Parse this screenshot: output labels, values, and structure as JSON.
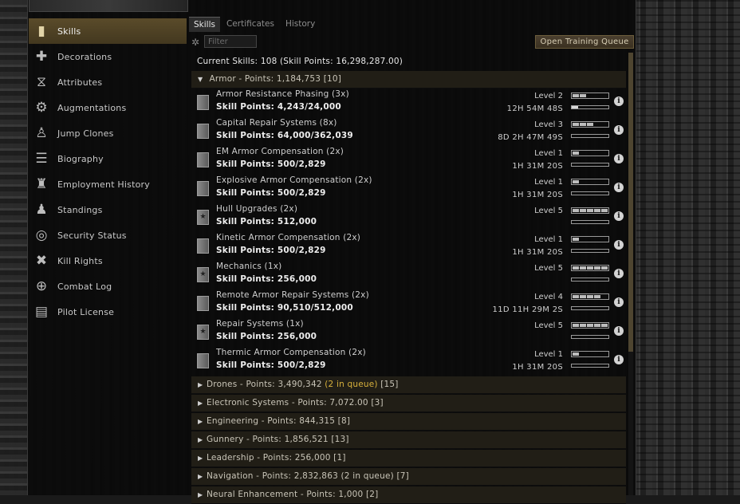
{
  "sidebar": {
    "items": [
      {
        "label": "Skills",
        "icon": "skill-book-icon",
        "glyph": "▮",
        "active": true
      },
      {
        "label": "Decorations",
        "icon": "medal-icon",
        "glyph": "✚",
        "active": false
      },
      {
        "label": "Attributes",
        "icon": "dna-icon",
        "glyph": "⧖",
        "active": false
      },
      {
        "label": "Augmentations",
        "icon": "implant-icon",
        "glyph": "⚙",
        "active": false
      },
      {
        "label": "Jump Clones",
        "icon": "clone-icon",
        "glyph": "♙",
        "active": false
      },
      {
        "label": "Biography",
        "icon": "biography-icon",
        "glyph": "☰",
        "active": false
      },
      {
        "label": "Employment History",
        "icon": "employment-icon",
        "glyph": "♜",
        "active": false
      },
      {
        "label": "Standings",
        "icon": "standings-icon",
        "glyph": "♟",
        "active": false
      },
      {
        "label": "Security Status",
        "icon": "security-icon",
        "glyph": "◎",
        "active": false
      },
      {
        "label": "Kill Rights",
        "icon": "kill-rights-icon",
        "glyph": "✖",
        "active": false
      },
      {
        "label": "Combat Log",
        "icon": "crosshair-icon",
        "glyph": "⊕",
        "active": false
      },
      {
        "label": "Pilot License",
        "icon": "license-icon",
        "glyph": "▤",
        "active": false
      }
    ]
  },
  "tabs": [
    {
      "label": "Skills",
      "active": true
    },
    {
      "label": "Certificates",
      "active": false
    },
    {
      "label": "History",
      "active": false
    }
  ],
  "filter": {
    "placeholder": "Filter",
    "value": ""
  },
  "queue_button": "Open Training Queue",
  "current_skills": "Current Skills: 108 (Skill Points: 16,298,287.00)",
  "armor_group": {
    "title": "Armor - Points: 1,184,753",
    "count": "[10]"
  },
  "skills": [
    {
      "name": "Armor Resistance Phasing (3x)",
      "points": "Skill Points: 4,243/24,000",
      "level": "Level 2",
      "level_num": 2,
      "time": "12H 54M 48S",
      "progress": 0.18,
      "icon": "skill-book-icon",
      "book": ""
    },
    {
      "name": "Capital Repair Systems (8x)",
      "points": "Skill Points: 64,000/362,039",
      "level": "Level 3",
      "level_num": 3,
      "time": "8D 2H 47M 49S",
      "progress": 0.0,
      "icon": "skill-book-icon",
      "book": ""
    },
    {
      "name": "EM Armor Compensation (2x)",
      "points": "Skill Points: 500/2,829",
      "level": "Level 1",
      "level_num": 1,
      "time": "1H 31M 20S",
      "progress": 0.0,
      "icon": "skill-book-icon",
      "book": ""
    },
    {
      "name": "Explosive Armor Compensation (2x)",
      "points": "Skill Points: 500/2,829",
      "level": "Level 1",
      "level_num": 1,
      "time": "1H 31M 20S",
      "progress": 0.0,
      "icon": "skill-book-icon",
      "book": ""
    },
    {
      "name": "Hull Upgrades (2x)",
      "points": "Skill Points: 512,000",
      "level": "Level 5",
      "level_num": 5,
      "time": "",
      "progress": 0.0,
      "icon": "skill-book-star-icon",
      "book": "★"
    },
    {
      "name": "Kinetic Armor Compensation (2x)",
      "points": "Skill Points: 500/2,829",
      "level": "Level 1",
      "level_num": 1,
      "time": "1H 31M 20S",
      "progress": 0.0,
      "icon": "skill-book-icon",
      "book": ""
    },
    {
      "name": "Mechanics (1x)",
      "points": "Skill Points: 256,000",
      "level": "Level 5",
      "level_num": 5,
      "time": "",
      "progress": 0.0,
      "icon": "skill-book-star-icon",
      "book": "★"
    },
    {
      "name": "Remote Armor Repair Systems (2x)",
      "points": "Skill Points: 90,510/512,000",
      "level": "Level 4",
      "level_num": 4,
      "time": "11D 11H 29M 2S",
      "progress": 0.0,
      "icon": "skill-book-icon",
      "book": ""
    },
    {
      "name": "Repair Systems (1x)",
      "points": "Skill Points: 256,000",
      "level": "Level 5",
      "level_num": 5,
      "time": "",
      "progress": 0.0,
      "icon": "skill-book-star-icon",
      "book": "★"
    },
    {
      "name": "Thermic Armor Compensation (2x)",
      "points": "Skill Points: 500/2,829",
      "level": "Level 1",
      "level_num": 1,
      "time": "1H 31M 20S",
      "progress": 0.0,
      "icon": "skill-book-icon",
      "book": ""
    }
  ],
  "groups": [
    {
      "title": "Drones - Points: 3,490,342",
      "queue": "(2 in queue)",
      "count": "[15]"
    },
    {
      "title": "Electronic Systems - Points: 7,072.00",
      "queue": "",
      "count": "[3]"
    },
    {
      "title": "Engineering - Points: 844,315",
      "queue": "",
      "count": "[8]"
    },
    {
      "title": "Gunnery - Points: 1,856,521",
      "queue": "",
      "count": "[13]"
    },
    {
      "title": "Leadership - Points: 256,000",
      "queue": "",
      "count": "[1]"
    },
    {
      "title": "Navigation - Points: 2,832,863 (2 in queue)",
      "queue": "",
      "count": "[7]"
    },
    {
      "title": "Neural Enhancement - Points: 1,000",
      "queue": "",
      "count": "[2]"
    }
  ],
  "colors": {
    "accent": "#5a4b2a",
    "queue": "#d8b13c"
  }
}
